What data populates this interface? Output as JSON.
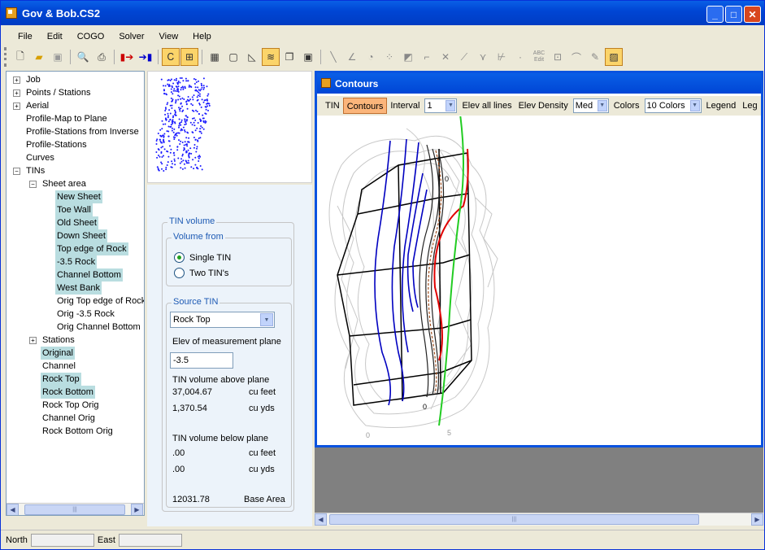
{
  "window": {
    "title": "Gov & Bob.CS2"
  },
  "menu": [
    "File",
    "Edit",
    "COGO",
    "Solver",
    "View",
    "Help"
  ],
  "toolbar": {
    "icons": [
      "new-icon",
      "open-icon",
      "save-icon",
      "print-preview-icon",
      "print-icon",
      "import-icon",
      "export-icon",
      "edit-text-icon",
      "zoom-extents-icon",
      "grid-icon",
      "window-icon",
      "profile-icon",
      "contours-icon",
      "copy-icon",
      "frame-icon",
      "line-icon",
      "angle-icon",
      "circle-icon",
      "points-icon",
      "tin-icon",
      "polyline-icon",
      "cross-icon",
      "slope-icon",
      "vector-icon",
      "dimension-icon",
      "dot-icon",
      "edit-abc-icon",
      "label-icon",
      "arc-icon",
      "pencil-icon",
      "hatch-icon"
    ],
    "abc_label": "ABC",
    "edit_label": "Edit"
  },
  "tree": {
    "items": [
      {
        "label": "Job",
        "level": 0,
        "exp": "+"
      },
      {
        "label": "Points / Stations",
        "level": 0,
        "exp": "+"
      },
      {
        "label": "Aerial",
        "level": 0,
        "exp": "+"
      },
      {
        "label": "Profile-Map to Plane",
        "level": 0
      },
      {
        "label": "Profile-Stations from Inverse",
        "level": 0
      },
      {
        "label": "Profile-Stations",
        "level": 0
      },
      {
        "label": "Curves",
        "level": 0
      },
      {
        "label": "TINs",
        "level": 0,
        "exp": "-"
      },
      {
        "label": "Sheet area",
        "level": 1,
        "exp": "-"
      },
      {
        "label": "New Sheet",
        "level": 2,
        "hl": true
      },
      {
        "label": "Toe Wall",
        "level": 2,
        "hl": true
      },
      {
        "label": "Old Sheet",
        "level": 2,
        "hl": true
      },
      {
        "label": "Down Sheet",
        "level": 2,
        "hl": true
      },
      {
        "label": "Top edge of Rock",
        "level": 2,
        "hl": true
      },
      {
        "label": "-3.5 Rock",
        "level": 2,
        "hl": true
      },
      {
        "label": "Channel Bottom",
        "level": 2,
        "hl": true
      },
      {
        "label": "West Bank",
        "level": 2,
        "hl": true
      },
      {
        "label": "Orig Top edge of Rock",
        "level": 2
      },
      {
        "label": "Orig -3.5 Rock",
        "level": 2
      },
      {
        "label": "Orig Channel Bottom",
        "level": 2
      },
      {
        "label": "Stations",
        "level": 1,
        "exp": "+"
      },
      {
        "label": "Original",
        "level": 1,
        "hl": true
      },
      {
        "label": "Channel",
        "level": 1
      },
      {
        "label": "Rock Top",
        "level": 1,
        "hl": true
      },
      {
        "label": "Rock Bottom",
        "level": 1,
        "hl": true
      },
      {
        "label": "Rock Top Orig",
        "level": 1
      },
      {
        "label": "Channel Orig",
        "level": 1
      },
      {
        "label": "Rock Bottom Orig",
        "level": 1
      }
    ]
  },
  "tin_volume": {
    "group_title": "TIN volume",
    "volume_from_title": "Volume from",
    "single_tin": "Single TIN",
    "two_tins": "Two TIN's",
    "source_title": "Source TIN",
    "source_value": "Rock Top",
    "elev_label": "Elev of measurement plane",
    "elev_value": "-3.5",
    "above_label": "TIN volume above plane",
    "above_cuft": "37,004.67",
    "above_cuyd": "1,370.54",
    "below_label": "TIN volume below plane",
    "below_cuft": ".00",
    "below_cuyd": ".00",
    "cuft_unit": "cu feet",
    "cuyd_unit": "cu yds",
    "base_area": "12031.78",
    "base_area_label": "Base Area"
  },
  "contours_window": {
    "title": "Contours",
    "toolbar": {
      "tin": "TIN",
      "contours": "Contours",
      "interval_label": "Interval",
      "interval_value": "1",
      "elev_all_lines": "Elev all lines",
      "elev_density_label": "Elev Density",
      "elev_density_value": "Med",
      "colors_label": "Colors",
      "colors_value": "10 Colors",
      "legend": "Legend",
      "legend2": "Leg"
    },
    "labels": {
      "zero": "0",
      "five": "5"
    }
  },
  "status": {
    "north_label": "North",
    "east_label": "East"
  },
  "colors": {
    "blue_contour": "#0000c0",
    "red_line": "#e00000",
    "green_line": "#22cc22",
    "highlight": "#b9dde0"
  }
}
